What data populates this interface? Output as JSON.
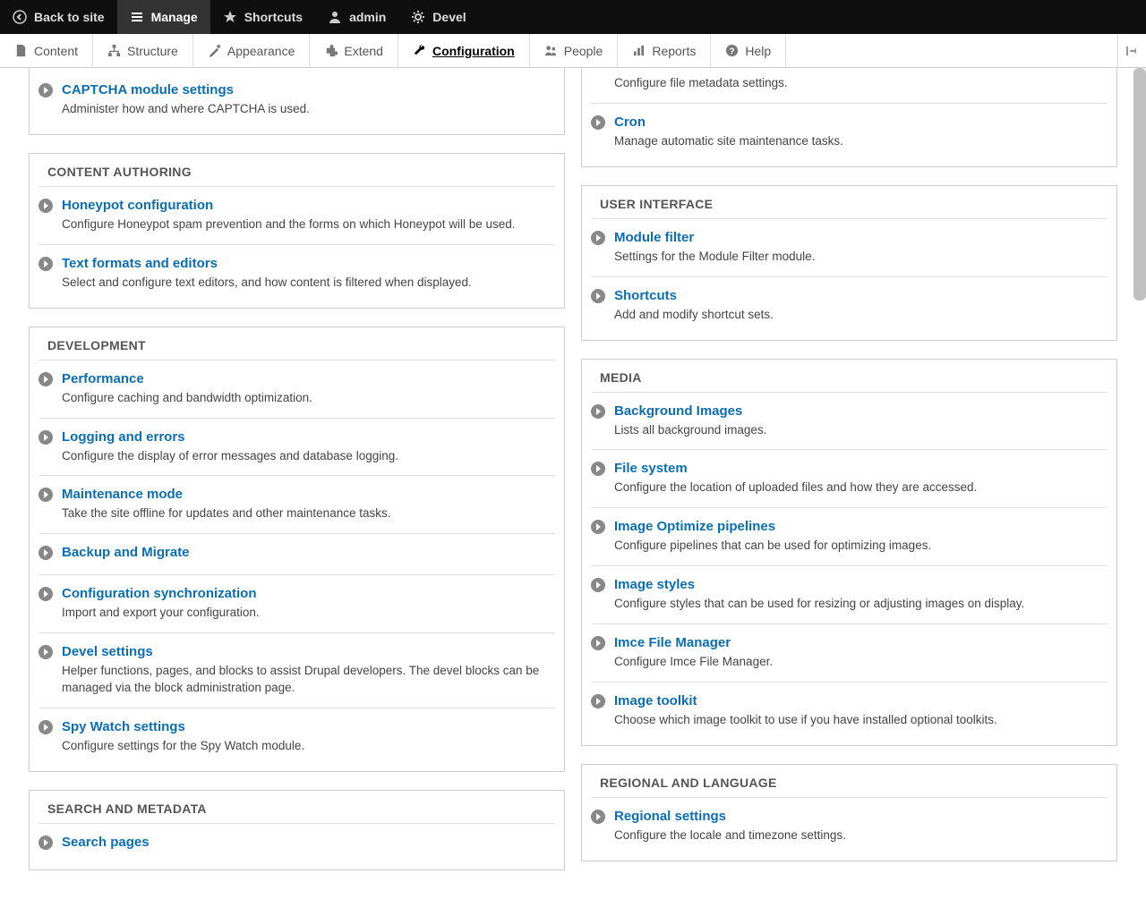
{
  "toolbar": {
    "back": "Back to site",
    "manage": "Manage",
    "shortcuts": "Shortcuts",
    "admin": "admin",
    "devel": "Devel"
  },
  "subbar": {
    "content": "Content",
    "structure": "Structure",
    "appearance": "Appearance",
    "extend": "Extend",
    "configuration": "Configuration",
    "people": "People",
    "reports": "Reports",
    "help": "Help"
  },
  "left": {
    "panel0": {
      "items": [
        {
          "title": "CAPTCHA module settings",
          "desc": "Administer how and where CAPTCHA is used."
        }
      ]
    },
    "panel1": {
      "header": "CONTENT AUTHORING",
      "items": [
        {
          "title": "Honeypot configuration",
          "desc": "Configure Honeypot spam prevention and the forms on which Honeypot will be used."
        },
        {
          "title": "Text formats and editors",
          "desc": "Select and configure text editors, and how content is filtered when displayed."
        }
      ]
    },
    "panel2": {
      "header": "DEVELOPMENT",
      "items": [
        {
          "title": "Performance",
          "desc": "Configure caching and bandwidth optimization."
        },
        {
          "title": "Logging and errors",
          "desc": "Configure the display of error messages and database logging."
        },
        {
          "title": "Maintenance mode",
          "desc": "Take the site offline for updates and other maintenance tasks."
        },
        {
          "title": "Backup and Migrate",
          "desc": ""
        },
        {
          "title": "Configuration synchronization",
          "desc": "Import and export your configuration."
        },
        {
          "title": "Devel settings",
          "desc": "Helper functions, pages, and blocks to assist Drupal developers. The devel blocks can be managed via the block administration page."
        },
        {
          "title": "Spy Watch settings",
          "desc": "Configure settings for the Spy Watch module."
        }
      ]
    },
    "panel3": {
      "header": "SEARCH AND METADATA",
      "items": [
        {
          "title": "Search pages",
          "desc": ""
        }
      ]
    }
  },
  "right": {
    "panel0": {
      "items": [
        {
          "title": "",
          "desc": "Configure file metadata settings."
        },
        {
          "title": "Cron",
          "desc": "Manage automatic site maintenance tasks."
        }
      ]
    },
    "panel1": {
      "header": "USER INTERFACE",
      "items": [
        {
          "title": "Module filter",
          "desc": "Settings for the Module Filter module."
        },
        {
          "title": "Shortcuts",
          "desc": "Add and modify shortcut sets."
        }
      ]
    },
    "panel2": {
      "header": "MEDIA",
      "items": [
        {
          "title": "Background Images",
          "desc": "Lists all background images."
        },
        {
          "title": "File system",
          "desc": "Configure the location of uploaded files and how they are accessed."
        },
        {
          "title": "Image Optimize pipelines",
          "desc": "Configure pipelines that can be used for optimizing images."
        },
        {
          "title": "Image styles",
          "desc": "Configure styles that can be used for resizing or adjusting images on display."
        },
        {
          "title": "Imce File Manager",
          "desc": "Configure Imce File Manager."
        },
        {
          "title": "Image toolkit",
          "desc": "Choose which image toolkit to use if you have installed optional toolkits."
        }
      ]
    },
    "panel3": {
      "header": "REGIONAL AND LANGUAGE",
      "items": [
        {
          "title": "Regional settings",
          "desc": "Configure the locale and timezone settings."
        }
      ]
    }
  }
}
